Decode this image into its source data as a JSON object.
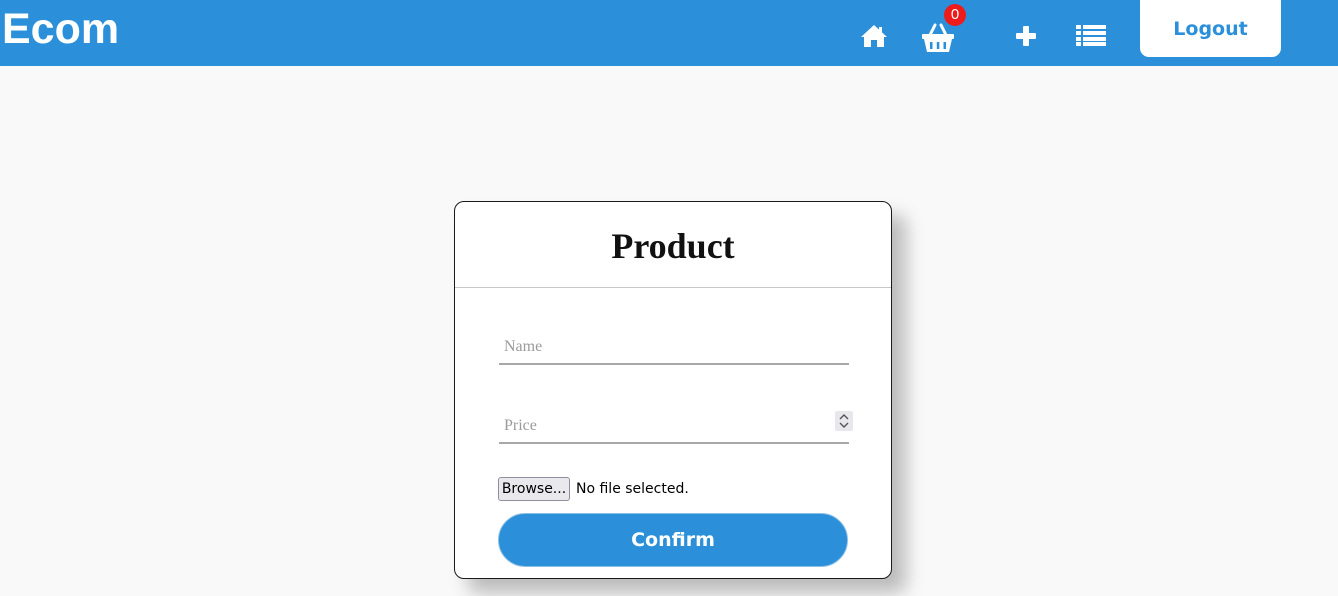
{
  "header": {
    "brand": "Ecom",
    "cart_count": "0",
    "logout_label": "Logout",
    "icons": [
      "home-icon",
      "basket-icon",
      "plus-icon",
      "list-icon"
    ]
  },
  "form": {
    "title": "Product",
    "name_placeholder": "Name",
    "price_placeholder": "Price",
    "browse_label": "Browse...",
    "file_status": "No file selected.",
    "confirm_label": "Confirm"
  },
  "colors": {
    "primary": "#2b90d9",
    "badge": "#ee1b1b",
    "background": "#f9f9f9"
  }
}
